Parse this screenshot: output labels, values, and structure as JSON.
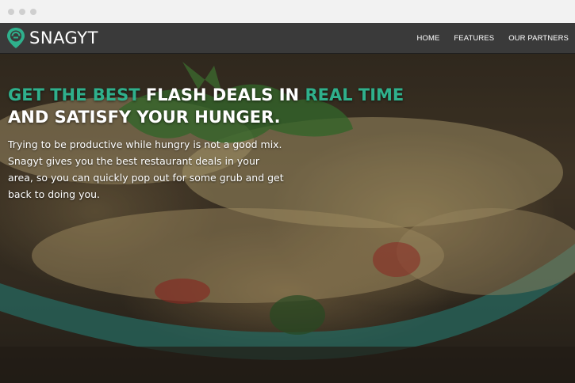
{
  "brand": {
    "name": "SNAGYT",
    "accent_color": "#2fb08c"
  },
  "nav": {
    "items": [
      {
        "label": "HOME"
      },
      {
        "label": "FEATURES"
      },
      {
        "label": "OUR PARTNERS"
      }
    ]
  },
  "hero": {
    "headline": {
      "part1_accent": "GET THE BEST",
      "part2": " FLASH DEALS IN ",
      "part3_accent": "REAL TIME",
      "line2": "AND SATISFY YOUR HUNGER."
    },
    "body": "Trying to be productive while hungry is not a good mix. Snagyt gives you the best restaurant deals in your area, so you can quickly pop out for some grub and get back to doing you."
  },
  "icons": {
    "logo": "map-pin-icon",
    "window_controls": [
      "window-dot-icon",
      "window-dot-icon",
      "window-dot-icon"
    ]
  }
}
